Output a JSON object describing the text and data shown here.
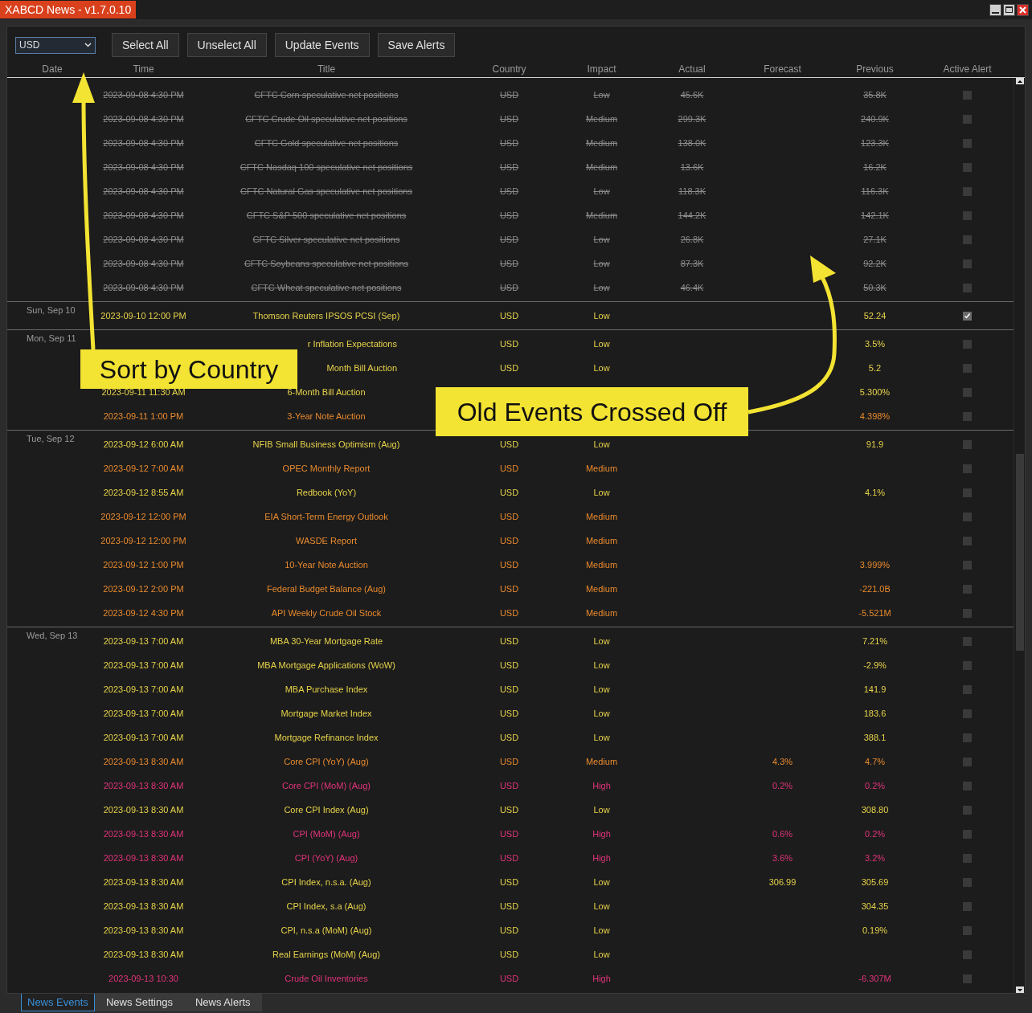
{
  "window": {
    "title": "XABCD News - v1.7.0.10"
  },
  "toolbar": {
    "currency": "USD",
    "buttons": [
      "Select All",
      "Unselect All",
      "Update Events",
      "Save Alerts"
    ]
  },
  "columns": [
    "Date",
    "Time",
    "Title",
    "Country",
    "Impact",
    "Actual",
    "Forecast",
    "Previous",
    "Active Alert"
  ],
  "groups": [
    {
      "rows": [
        {
          "time": "2023-09-08 4:30 PM",
          "title": "CFTC Corn speculative net positions",
          "country": "USD",
          "impact": "Low",
          "actual": "45.6K",
          "previous": "35.8K",
          "color": "#8c8c8c",
          "passed": true,
          "alert": false
        },
        {
          "time": "2023-09-08 4:30 PM",
          "title": "CFTC Crude Oil speculative net positions",
          "country": "USD",
          "impact": "Medium",
          "actual": "299.3K",
          "previous": "240.9K",
          "color": "#8c8c8c",
          "passed": true,
          "alert": false
        },
        {
          "time": "2023-09-08 4:30 PM",
          "title": "CFTC Gold speculative net positions",
          "country": "USD",
          "impact": "Medium",
          "actual": "138.0K",
          "previous": "123.3K",
          "color": "#8c8c8c",
          "passed": true,
          "alert": false
        },
        {
          "time": "2023-09-08 4:30 PM",
          "title": "CFTC Nasdaq 100 speculative net positions",
          "country": "USD",
          "impact": "Medium",
          "actual": "13.6K",
          "previous": "16.2K",
          "color": "#8c8c8c",
          "passed": true,
          "alert": false
        },
        {
          "time": "2023-09-08 4:30 PM",
          "title": "CFTC Natural Gas speculative net positions",
          "country": "USD",
          "impact": "Low",
          "actual": "118.3K",
          "previous": "116.3K",
          "color": "#8c8c8c",
          "passed": true,
          "alert": false
        },
        {
          "time": "2023-09-08 4:30 PM",
          "title": "CFTC S&P 500 speculative net positions",
          "country": "USD",
          "impact": "Medium",
          "actual": "144.2K",
          "previous": "142.1K",
          "color": "#8c8c8c",
          "passed": true,
          "alert": false
        },
        {
          "time": "2023-09-08 4:30 PM",
          "title": "CFTC Silver speculative net positions",
          "country": "USD",
          "impact": "Low",
          "actual": "26.8K",
          "previous": "27.1K",
          "color": "#8c8c8c",
          "passed": true,
          "alert": false
        },
        {
          "time": "2023-09-08 4:30 PM",
          "title": "CFTC Soybeans speculative net positions",
          "country": "USD",
          "impact": "Low",
          "actual": "87.3K",
          "previous": "92.2K",
          "color": "#8c8c8c",
          "passed": true,
          "alert": false
        },
        {
          "time": "2023-09-08 4:30 PM",
          "title": "CFTC Wheat speculative net positions",
          "country": "USD",
          "impact": "Low",
          "actual": "46.4K",
          "previous": "50.3K",
          "color": "#8c8c8c",
          "passed": true,
          "alert": false
        }
      ]
    },
    {
      "date": "Sun, Sep 10",
      "rows": [
        {
          "time": "2023-09-10 12:00 PM",
          "title": "Thomson Reuters IPSOS PCSI (Sep)",
          "country": "USD",
          "impact": "Low",
          "previous": "52.24",
          "color": "#e6d24a",
          "passed": false,
          "alert": true
        }
      ]
    },
    {
      "date": "Mon, Sep 11",
      "rows": [
        {
          "title": "r Inflation Expectations",
          "cut_start": true,
          "country": "USD",
          "impact": "Low",
          "previous": "3.5%",
          "color": "#e6d24a",
          "passed": false,
          "alert": false
        },
        {
          "title": "Month Bill Auction",
          "cut_start": true,
          "country": "USD",
          "impact": "Low",
          "previous": "5.2",
          "color": "#e6d24a",
          "passed": false,
          "alert": false
        },
        {
          "time": "2023-09-11 11:30 AM",
          "title": "6-Month Bill Auction",
          "previous": "5.300%",
          "color": "#e6d24a",
          "passed": false,
          "alert": false
        },
        {
          "time": "2023-09-11 1:00 PM",
          "title": "3-Year Note Auction",
          "previous": "4.398%",
          "color": "#e88a2e",
          "passed": false,
          "alert": false
        }
      ]
    },
    {
      "date": "Tue, Sep 12",
      "rows": [
        {
          "time": "2023-09-12 6:00 AM",
          "title": "NFIB Small Business Optimism (Aug)",
          "country": "USD",
          "impact": "Low",
          "previous": "91.9",
          "color": "#e6d24a",
          "passed": false,
          "alert": false
        },
        {
          "time": "2023-09-12 7:00 AM",
          "title": "OPEC Monthly Report",
          "country": "USD",
          "impact": "Medium",
          "color": "#e88a2e",
          "passed": false,
          "alert": false
        },
        {
          "time": "2023-09-12 8:55 AM",
          "title": "Redbook (YoY)",
          "country": "USD",
          "impact": "Low",
          "previous": "4.1%",
          "color": "#e6d24a",
          "passed": false,
          "alert": false
        },
        {
          "time": "2023-09-12 12:00 PM",
          "title": "EIA Short-Term Energy Outlook",
          "country": "USD",
          "impact": "Medium",
          "color": "#e88a2e",
          "passed": false,
          "alert": false
        },
        {
          "time": "2023-09-12 12:00 PM",
          "title": "WASDE Report",
          "country": "USD",
          "impact": "Medium",
          "color": "#e88a2e",
          "passed": false,
          "alert": false
        },
        {
          "time": "2023-09-12 1:00 PM",
          "title": "10-Year Note Auction",
          "country": "USD",
          "impact": "Medium",
          "previous": "3.999%",
          "color": "#e88a2e",
          "passed": false,
          "alert": false
        },
        {
          "time": "2023-09-12 2:00 PM",
          "title": "Federal Budget Balance (Aug)",
          "country": "USD",
          "impact": "Medium",
          "previous": "-221.0B",
          "color": "#e88a2e",
          "passed": false,
          "alert": false
        },
        {
          "time": "2023-09-12 4:30 PM",
          "title": "API Weekly Crude Oil Stock",
          "country": "USD",
          "impact": "Medium",
          "previous": "-5.521M",
          "color": "#e88a2e",
          "passed": false,
          "alert": false
        }
      ]
    },
    {
      "date": "Wed, Sep 13",
      "rows": [
        {
          "time": "2023-09-13 7:00 AM",
          "title": "MBA 30-Year Mortgage Rate",
          "country": "USD",
          "impact": "Low",
          "previous": "7.21%",
          "color": "#e6d24a",
          "passed": false,
          "alert": false
        },
        {
          "time": "2023-09-13 7:00 AM",
          "title": "MBA Mortgage Applications (WoW)",
          "country": "USD",
          "impact": "Low",
          "previous": "-2.9%",
          "color": "#e6d24a",
          "passed": false,
          "alert": false
        },
        {
          "time": "2023-09-13 7:00 AM",
          "title": "MBA Purchase Index",
          "country": "USD",
          "impact": "Low",
          "previous": "141.9",
          "color": "#e6d24a",
          "passed": false,
          "alert": false
        },
        {
          "time": "2023-09-13 7:00 AM",
          "title": "Mortgage Market Index",
          "country": "USD",
          "impact": "Low",
          "previous": "183.6",
          "color": "#e6d24a",
          "passed": false,
          "alert": false
        },
        {
          "time": "2023-09-13 7:00 AM",
          "title": "Mortgage Refinance Index",
          "country": "USD",
          "impact": "Low",
          "previous": "388.1",
          "color": "#e6d24a",
          "passed": false,
          "alert": false
        },
        {
          "time": "2023-09-13 8:30 AM",
          "title": "Core CPI (YoY) (Aug)",
          "country": "USD",
          "impact": "Medium",
          "forecast": "4.3%",
          "previous": "4.7%",
          "color": "#e88a2e",
          "passed": false,
          "alert": false
        },
        {
          "time": "2023-09-13 8:30 AM",
          "title": "Core CPI (MoM) (Aug)",
          "country": "USD",
          "impact": "High",
          "forecast": "0.2%",
          "previous": "0.2%",
          "color": "#e0337a",
          "passed": false,
          "alert": false
        },
        {
          "time": "2023-09-13 8:30 AM",
          "title": "Core CPI Index (Aug)",
          "country": "USD",
          "impact": "Low",
          "previous": "308.80",
          "color": "#e6d24a",
          "passed": false,
          "alert": false
        },
        {
          "time": "2023-09-13 8:30 AM",
          "title": "CPI (MoM) (Aug)",
          "country": "USD",
          "impact": "High",
          "forecast": "0.6%",
          "previous": "0.2%",
          "color": "#e0337a",
          "passed": false,
          "alert": false
        },
        {
          "time": "2023-09-13 8:30 AM",
          "title": "CPI (YoY) (Aug)",
          "country": "USD",
          "impact": "High",
          "forecast": "3.6%",
          "previous": "3.2%",
          "color": "#e0337a",
          "passed": false,
          "alert": false
        },
        {
          "time": "2023-09-13 8:30 AM",
          "title": "CPI Index, n.s.a. (Aug)",
          "country": "USD",
          "impact": "Low",
          "forecast": "306.99",
          "previous": "305.69",
          "color": "#e6d24a",
          "passed": false,
          "alert": false
        },
        {
          "time": "2023-09-13 8:30 AM",
          "title": "CPI Index, s.a (Aug)",
          "country": "USD",
          "impact": "Low",
          "previous": "304.35",
          "color": "#e6d24a",
          "passed": false,
          "alert": false
        },
        {
          "time": "2023-09-13 8:30 AM",
          "title": "CPI, n.s.a (MoM) (Aug)",
          "country": "USD",
          "impact": "Low",
          "previous": "0.19%",
          "color": "#e6d24a",
          "passed": false,
          "alert": false
        },
        {
          "time": "2023-09-13 8:30 AM",
          "title": "Real Earnings (MoM) (Aug)",
          "country": "USD",
          "impact": "Low",
          "color": "#e6d24a",
          "passed": false,
          "alert": false
        },
        {
          "time": "2023-09-13 10:30",
          "title": "Crude Oil Inventories",
          "country": "USD",
          "impact": "High",
          "previous": "-6.307M",
          "color": "#e0337a",
          "passed": false,
          "alert": false
        }
      ]
    }
  ],
  "tabs": [
    {
      "label": "News Events",
      "selected": true
    },
    {
      "label": "News Settings",
      "selected": false
    },
    {
      "label": "News Alerts",
      "selected": false
    }
  ],
  "callouts": [
    "Sort by Country",
    "Old Events Crossed Off"
  ]
}
